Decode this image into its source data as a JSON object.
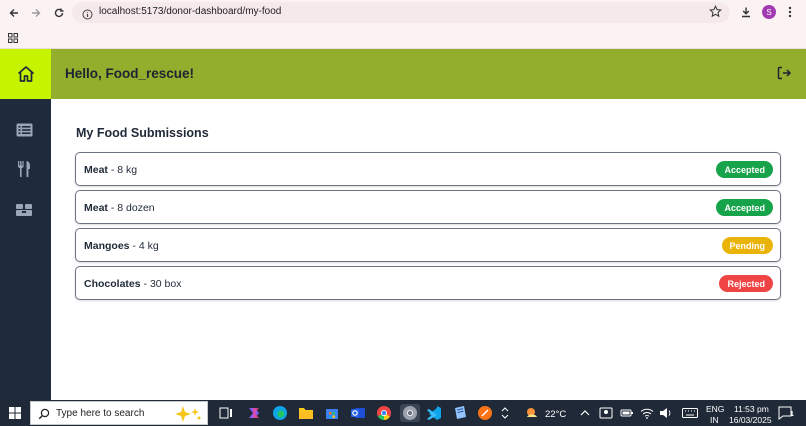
{
  "browser": {
    "url": "localhost:5173/donor-dashboard/my-food",
    "profile_initial": "S"
  },
  "app": {
    "greeting": "Hello, Food_rescue!",
    "page_title": "My Food Submissions",
    "items": [
      {
        "name": "Meat",
        "quantity": " - 8 kg",
        "status": "Accepted",
        "status_color": "#16a34a"
      },
      {
        "name": "Meat",
        "quantity": " - 8 dozen",
        "status": "Accepted",
        "status_color": "#16a34a"
      },
      {
        "name": "Mangoes",
        "quantity": " - 4 kg",
        "status": "Pending",
        "status_color": "#eab308"
      },
      {
        "name": "Chocolates",
        "quantity": " - 30 box",
        "status": "Rejected",
        "status_color": "#ef4444"
      }
    ],
    "colors": {
      "sidebar": "#1f2a3c",
      "home_tile": "#c6f400",
      "header": "#93ad2c"
    }
  },
  "taskbar": {
    "search_placeholder": "Type here to search",
    "weather": "22°C",
    "lang_top": "ENG",
    "lang_bottom": "IN",
    "time": "11:53 pm",
    "date": "16/03/2025",
    "notification_count": "1"
  }
}
